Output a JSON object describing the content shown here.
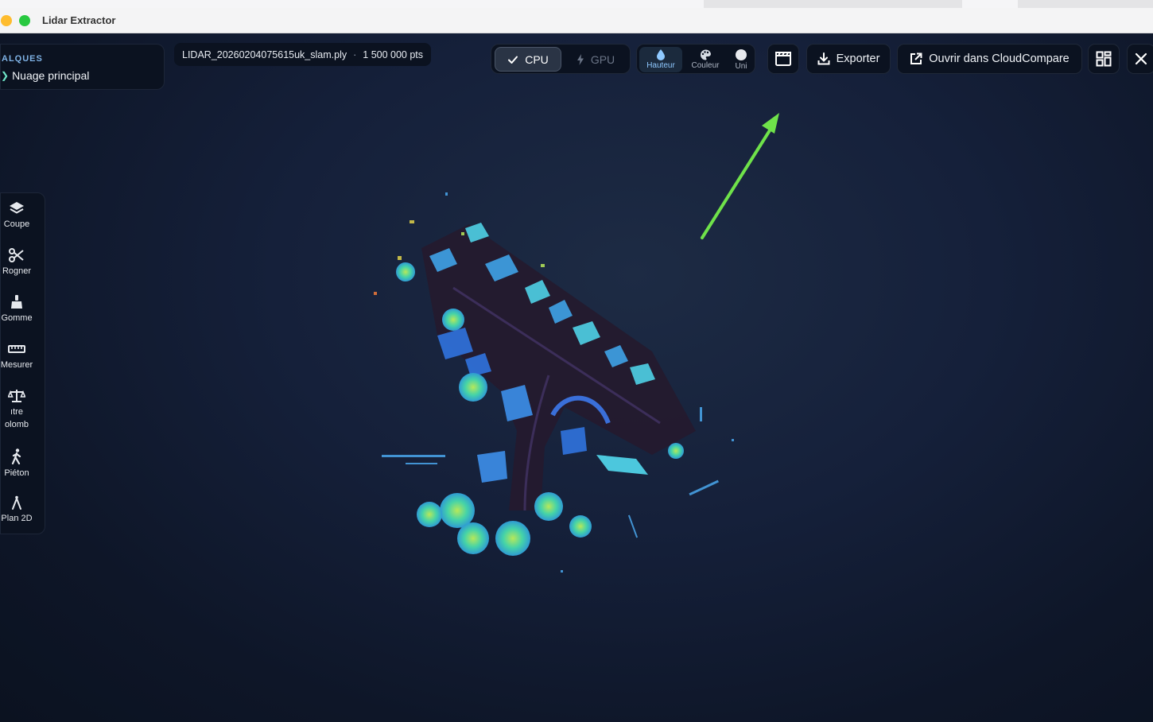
{
  "window": {
    "title": "Lidar Extractor"
  },
  "layers": {
    "title": "ALQUES",
    "item": "Nuage principal"
  },
  "file": {
    "name": "LIDAR_20260204075615uk_slam.ply",
    "separator": "·",
    "points": "1 500 000 pts"
  },
  "compute": {
    "cpu_label": "CPU",
    "gpu_label": "GPU",
    "active": "CPU"
  },
  "color_modes": {
    "hauteur": "Hauteur",
    "couleur": "Couleur",
    "uni": "Uni",
    "active": "Hauteur"
  },
  "actions": {
    "export": "Exporter",
    "open_cc": "Ouvrir dans CloudCompare"
  },
  "tools": [
    {
      "label": "Coupe",
      "icon": "layers-icon"
    },
    {
      "label": "Rogner",
      "icon": "scissors-icon"
    },
    {
      "label": "Gomme",
      "icon": "brush-icon"
    },
    {
      "label": "Mesurer",
      "icon": "ruler-icon"
    },
    {
      "label": "ıtre\nolomb",
      "icon": "scale-icon"
    },
    {
      "label": "Piéton",
      "icon": "walk-icon"
    },
    {
      "label": "Plan 2D",
      "icon": "compass-icon"
    }
  ],
  "colors": {
    "accent": "#8fc9ff",
    "annotation_arrow": "#6fe24a",
    "background": "#0d1525"
  }
}
